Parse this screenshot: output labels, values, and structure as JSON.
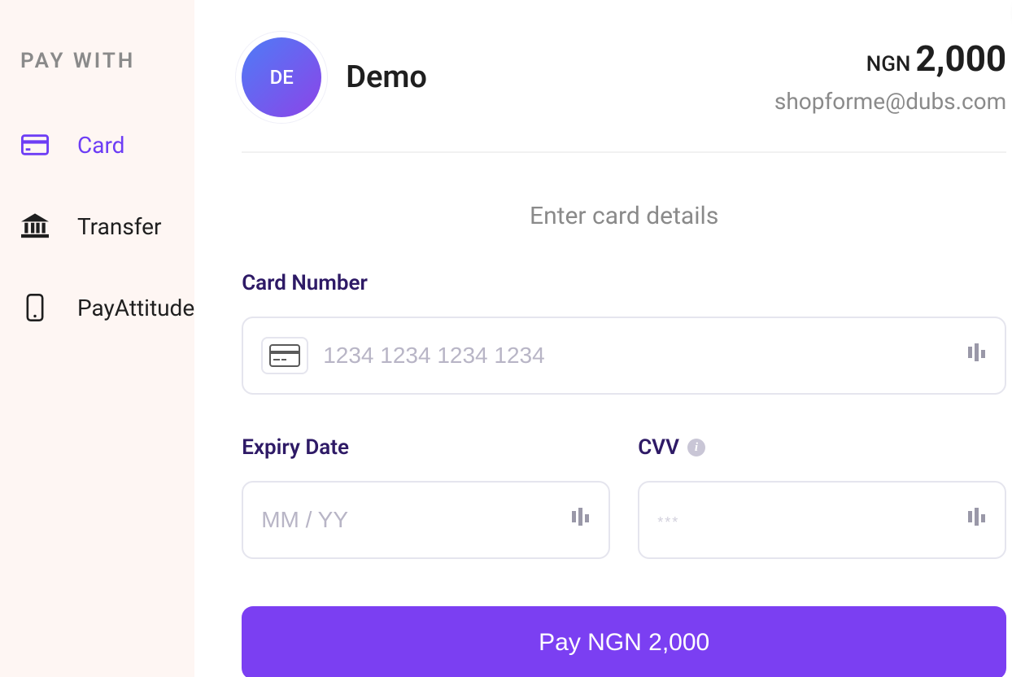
{
  "sidebar": {
    "title": "PAY WITH",
    "items": [
      {
        "label": "Card",
        "icon": "card-icon",
        "active": true
      },
      {
        "label": "Transfer",
        "icon": "bank-icon",
        "active": false
      },
      {
        "label": "PayAttitude",
        "icon": "phone-icon",
        "active": false
      }
    ]
  },
  "header": {
    "merchant_initials": "DE",
    "merchant_name": "Demo",
    "currency": "NGN",
    "amount": "2,000",
    "customer_email": "shopforme@dubs.com"
  },
  "form": {
    "title": "Enter card details",
    "card_number_label": "Card Number",
    "card_number_placeholder": "1234 1234 1234 1234",
    "expiry_label": "Expiry Date",
    "expiry_placeholder": "MM / YY",
    "cvv_label": "CVV",
    "cvv_placeholder": "***",
    "pay_button": "Pay NGN 2,000"
  },
  "colors": {
    "accent": "#6D3DF5",
    "button": "#7B3FF2",
    "sidebar_bg": "#FEF6F3",
    "label": "#2E1A66",
    "muted": "#8A8A8A"
  }
}
